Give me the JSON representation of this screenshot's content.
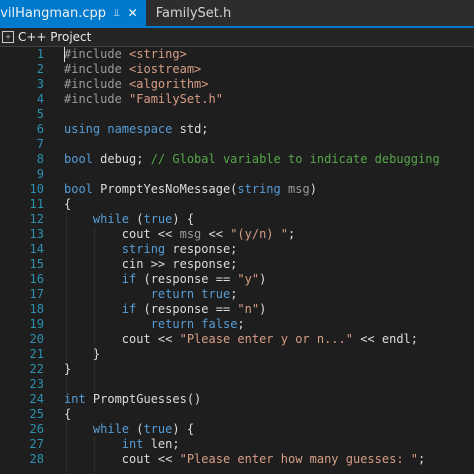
{
  "tabs": [
    {
      "label": "EvilHangman.cpp",
      "pin_icon": "pin",
      "close_icon": "close",
      "active": true
    },
    {
      "label": "FamilySet.h",
      "active": false
    }
  ],
  "navbar": {
    "project_icon": "cpp-project-icon",
    "label": "C++ Project"
  },
  "colors": {
    "accent": "#007acc",
    "background": "#1e1e1e",
    "line_number": "#2b91af",
    "keyword": "#569cd6",
    "string": "#d69d85",
    "comment": "#57a64a",
    "preprocessor": "#9b9b9b"
  },
  "code_lines": [
    {
      "n": "1",
      "segs": [
        [
          "pp",
          "#include "
        ],
        [
          "str",
          "<string>"
        ]
      ]
    },
    {
      "n": "2",
      "segs": [
        [
          "pp",
          "#include "
        ],
        [
          "str",
          "<iostream>"
        ]
      ]
    },
    {
      "n": "3",
      "segs": [
        [
          "pp",
          "#include "
        ],
        [
          "str",
          "<algorithm>"
        ]
      ]
    },
    {
      "n": "4",
      "segs": [
        [
          "pp",
          "#include "
        ],
        [
          "str",
          "\"FamilySet.h\""
        ]
      ]
    },
    {
      "n": "5",
      "segs": []
    },
    {
      "n": "6",
      "segs": [
        [
          "kw",
          "using"
        ],
        [
          "",
          " "
        ],
        [
          "kw",
          "namespace"
        ],
        [
          "",
          " std;"
        ]
      ]
    },
    {
      "n": "7",
      "segs": []
    },
    {
      "n": "8",
      "segs": [
        [
          "kw",
          "bool"
        ],
        [
          "",
          " debug; "
        ],
        [
          "cm",
          "// Global variable to indicate debugging"
        ]
      ]
    },
    {
      "n": "9",
      "segs": []
    },
    {
      "n": "10",
      "segs": [
        [
          "kw",
          "bool"
        ],
        [
          "",
          " PromptYesNoMessage("
        ],
        [
          "kw",
          "string"
        ],
        [
          "",
          " "
        ],
        [
          "param",
          "msg"
        ],
        [
          "",
          ")"
        ]
      ]
    },
    {
      "n": "11",
      "segs": [
        [
          "",
          "{"
        ]
      ]
    },
    {
      "n": "12",
      "segs": [
        [
          "",
          "    "
        ],
        [
          "kw",
          "while"
        ],
        [
          "",
          " ("
        ],
        [
          "kw",
          "true"
        ],
        [
          "",
          ") {"
        ]
      ]
    },
    {
      "n": "13",
      "segs": [
        [
          "",
          "        cout << "
        ],
        [
          "param",
          "msg"
        ],
        [
          "",
          " << "
        ],
        [
          "str",
          "\"(y/n) \""
        ],
        [
          "",
          ";"
        ]
      ]
    },
    {
      "n": "14",
      "segs": [
        [
          "",
          "        "
        ],
        [
          "kw",
          "string"
        ],
        [
          "",
          " response;"
        ]
      ]
    },
    {
      "n": "15",
      "segs": [
        [
          "",
          "        cin >> response;"
        ]
      ]
    },
    {
      "n": "16",
      "segs": [
        [
          "",
          "        "
        ],
        [
          "kw",
          "if"
        ],
        [
          "",
          " (response == "
        ],
        [
          "str",
          "\"y\""
        ],
        [
          "",
          ")"
        ]
      ]
    },
    {
      "n": "17",
      "segs": [
        [
          "",
          "            "
        ],
        [
          "kw",
          "return"
        ],
        [
          "",
          " "
        ],
        [
          "kw",
          "true"
        ],
        [
          "",
          ";"
        ]
      ]
    },
    {
      "n": "18",
      "segs": [
        [
          "",
          "        "
        ],
        [
          "kw",
          "if"
        ],
        [
          "",
          " (response == "
        ],
        [
          "str",
          "\"n\""
        ],
        [
          "",
          ")"
        ]
      ]
    },
    {
      "n": "19",
      "segs": [
        [
          "",
          "            "
        ],
        [
          "kw",
          "return"
        ],
        [
          "",
          " "
        ],
        [
          "kw",
          "false"
        ],
        [
          "",
          ";"
        ]
      ]
    },
    {
      "n": "20",
      "segs": [
        [
          "",
          "        cout << "
        ],
        [
          "str",
          "\"Please enter y or n...\""
        ],
        [
          "",
          " << endl;"
        ]
      ]
    },
    {
      "n": "21",
      "segs": [
        [
          "",
          "    }"
        ]
      ]
    },
    {
      "n": "22",
      "segs": [
        [
          "",
          "}"
        ]
      ]
    },
    {
      "n": "23",
      "segs": []
    },
    {
      "n": "24",
      "segs": [
        [
          "kw",
          "int"
        ],
        [
          "",
          " PromptGuesses()"
        ]
      ]
    },
    {
      "n": "25",
      "segs": [
        [
          "",
          "{"
        ]
      ]
    },
    {
      "n": "26",
      "segs": [
        [
          "",
          "    "
        ],
        [
          "kw",
          "while"
        ],
        [
          "",
          " ("
        ],
        [
          "kw",
          "true"
        ],
        [
          "",
          ") {"
        ]
      ]
    },
    {
      "n": "27",
      "segs": [
        [
          "",
          "        "
        ],
        [
          "kw",
          "int"
        ],
        [
          "",
          " len;"
        ]
      ]
    },
    {
      "n": "28",
      "segs": [
        [
          "",
          "        cout << "
        ],
        [
          "str",
          "\"Please enter how many guesses: \""
        ],
        [
          "",
          ";"
        ]
      ]
    }
  ]
}
